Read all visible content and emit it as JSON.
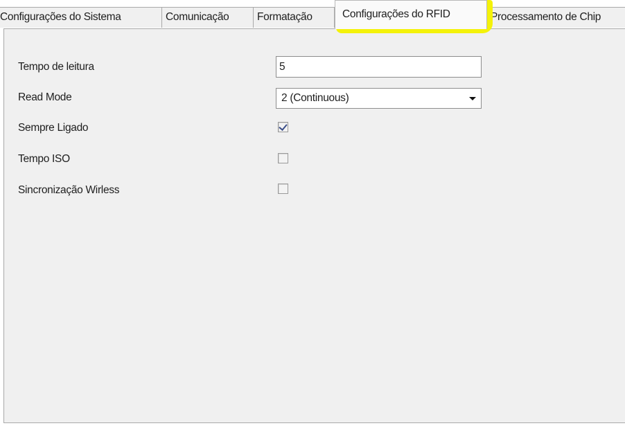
{
  "tabs": [
    {
      "label": "Configurações do Sistema",
      "selected": false
    },
    {
      "label": "Comunicação",
      "selected": false
    },
    {
      "label": "Formatação",
      "selected": false
    },
    {
      "label": "Configurações do RFID",
      "selected": true,
      "highlight_color": "#f4f20a"
    },
    {
      "label": "Processamento de Chip",
      "selected": false
    }
  ],
  "form": {
    "read_time_label": "Tempo de leitura",
    "read_time_value": "5",
    "read_mode_label": "Read Mode",
    "read_mode_value": "2 (Continuous)",
    "always_on_label": "Sempre Ligado",
    "always_on_checked": true,
    "iso_time_label": "Tempo ISO",
    "iso_time_checked": false,
    "wireless_sync_label": "Sincronização Wirless",
    "wireless_sync_checked": false
  },
  "colors": {
    "panel_background": "#f0f0f0",
    "highlight": "#f4f20a",
    "border": "#a9a9a9"
  }
}
